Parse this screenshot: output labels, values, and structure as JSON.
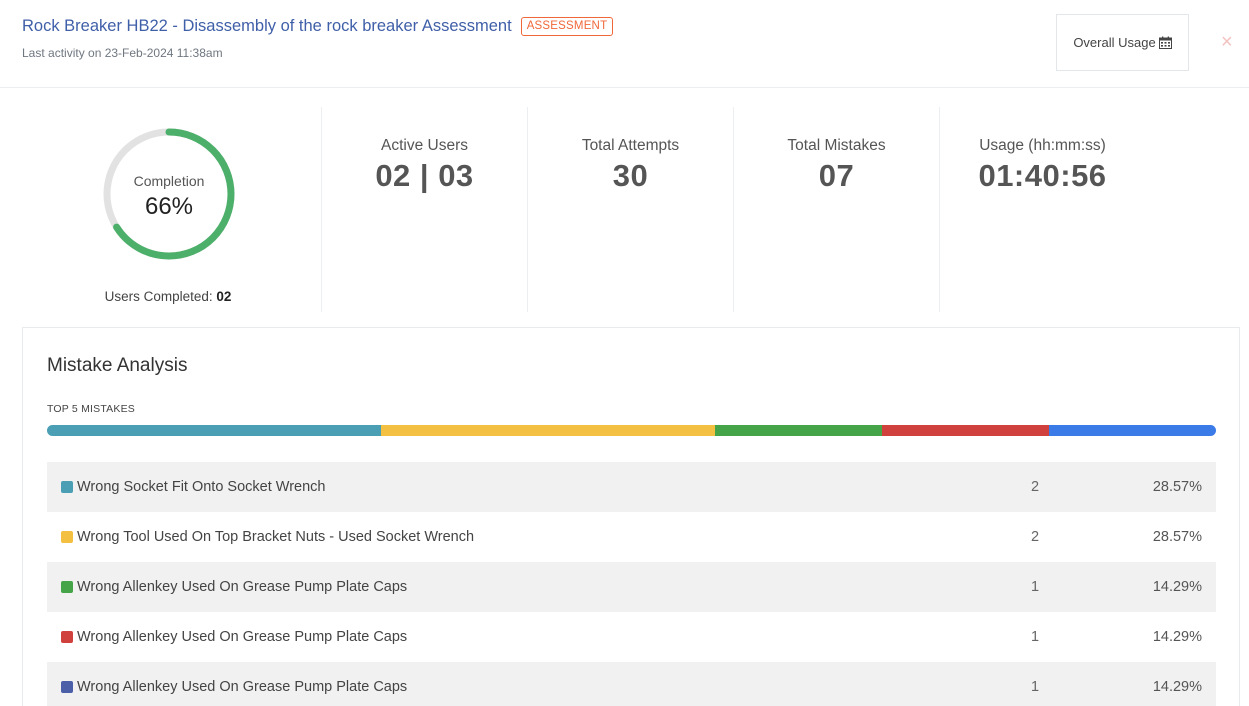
{
  "header": {
    "title": "Rock Breaker HB22 - Disassembly of the rock breaker Assessment",
    "badge": "ASSESSMENT",
    "last_activity": "Last activity on 23-Feb-2024 11:38am",
    "usage_button_label": "Overall Usage",
    "usage_button_icon": "calendar-icon",
    "close_label": "×"
  },
  "completion": {
    "label": "Completion",
    "value": "66%",
    "percent": 66,
    "users_completed_label": "Users Completed:",
    "users_completed_value": "02",
    "ring_color": "#4caf6a"
  },
  "stats": [
    {
      "label": "Active Users",
      "value": "02 | 03"
    },
    {
      "label": "Total Attempts",
      "value": "30"
    },
    {
      "label": "Total Mistakes",
      "value": "07"
    },
    {
      "label": "Usage (hh:mm:ss)",
      "value": "01:40:56"
    }
  ],
  "mistake_analysis": {
    "title": "Mistake Analysis",
    "subtitle": "TOP 5 MISTAKES",
    "bar_segments": [
      {
        "color": "#4a9fb5",
        "percent": 28.57
      },
      {
        "color": "#f4c042",
        "percent": 28.57
      },
      {
        "color": "#45a348",
        "percent": 14.29
      },
      {
        "color": "#d0413e",
        "percent": 14.29
      },
      {
        "color": "#3b7be8",
        "percent": 14.29
      }
    ],
    "rows": [
      {
        "label": "Wrong Socket Fit Onto Socket Wrench",
        "count": "2",
        "percent": "28.57%",
        "color": "#4a9fb5"
      },
      {
        "label": "Wrong Tool Used On Top Bracket Nuts - Used Socket Wrench",
        "count": "2",
        "percent": "28.57%",
        "color": "#f4c042"
      },
      {
        "label": "Wrong Allenkey Used On Grease Pump Plate Caps",
        "count": "1",
        "percent": "14.29%",
        "color": "#45a348"
      },
      {
        "label": "Wrong Allenkey Used On Grease Pump Plate Caps",
        "count": "1",
        "percent": "14.29%",
        "color": "#d0413e"
      },
      {
        "label": "Wrong Allenkey Used On Grease Pump Plate Caps",
        "count": "1",
        "percent": "14.29%",
        "color": "#4a5fa8"
      }
    ]
  }
}
